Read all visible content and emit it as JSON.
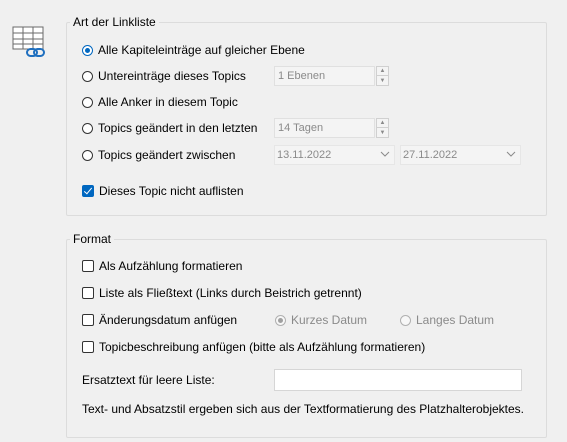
{
  "icon": "link-list-table-icon",
  "link_type_group": {
    "title": "Art der Linkliste",
    "options": [
      {
        "label": "Alle Kapiteleinträge auf gleicher Ebene",
        "selected": true
      },
      {
        "label": "Untereinträge dieses Topics",
        "selected": false
      },
      {
        "label": "Alle Anker in diesem Topic",
        "selected": false
      },
      {
        "label": "Topics geändert in den letzten",
        "selected": false
      },
      {
        "label": "Topics geändert zwischen",
        "selected": false
      }
    ],
    "levels_value": "1 Ebenen",
    "days_value": "14 Tagen",
    "date_from": "13.11.2022",
    "date_to": "27.11.2022",
    "exclude_label": "Dieses Topic nicht auflisten",
    "exclude_checked": true
  },
  "format_group": {
    "title": "Format",
    "as_list_label": "Als Aufzählung formatieren",
    "as_list_checked": false,
    "flow_text_label": "Liste als Fließtext (Links durch Beistrich getrennt)",
    "flow_text_checked": false,
    "append_date_label": "Änderungsdatum anfügen",
    "append_date_checked": false,
    "short_date_label": "Kurzes Datum",
    "short_date_selected": true,
    "long_date_label": "Langes Datum",
    "long_date_selected": false,
    "append_desc_label": "Topicbeschreibung anfügen (bitte als Aufzählung formatieren)",
    "append_desc_checked": false,
    "empty_list_label": "Ersatztext für leere Liste:",
    "empty_list_value": "",
    "info_text": "Text- und Absatzstil ergeben sich aus der Textformatierung des Platzhalterobjektes."
  },
  "colors": {
    "accent": "#0067c0",
    "background": "#f0f0f0"
  }
}
